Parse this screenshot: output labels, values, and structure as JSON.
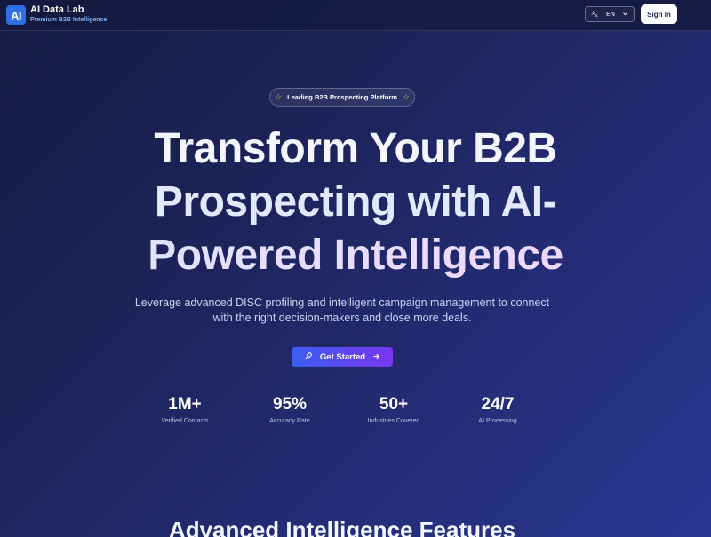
{
  "header": {
    "logo_text": "AI",
    "brand_name": "AI Data Lab",
    "brand_tagline": "Premium B2B Intelligence",
    "language": "EN",
    "signin_label": "Sign In"
  },
  "hero": {
    "badge_text": "Leading B2B Prospecting Platform",
    "title_line1": "Transform Your B2B",
    "title_line2": "Prospecting with AI-",
    "title_line3": "Powered Intelligence",
    "subtitle": "Leverage advanced DISC profiling and intelligent campaign management to connect with the right decision-makers and close more deals.",
    "cta_label": "Get Started"
  },
  "stats": [
    {
      "value": "1M+",
      "label": "Verified Contacts"
    },
    {
      "value": "95%",
      "label": "Accuracy Rate"
    },
    {
      "value": "50+",
      "label": "Industries Covered"
    },
    {
      "value": "24/7",
      "label": "AI Processing"
    }
  ],
  "features": {
    "heading": "Advanced Intelligence Features"
  },
  "colors": {
    "accent_start": "#3b5ff0",
    "accent_end": "#7a35ee",
    "star": "#f2c94c",
    "logo_bg": "#2f6fe6"
  }
}
